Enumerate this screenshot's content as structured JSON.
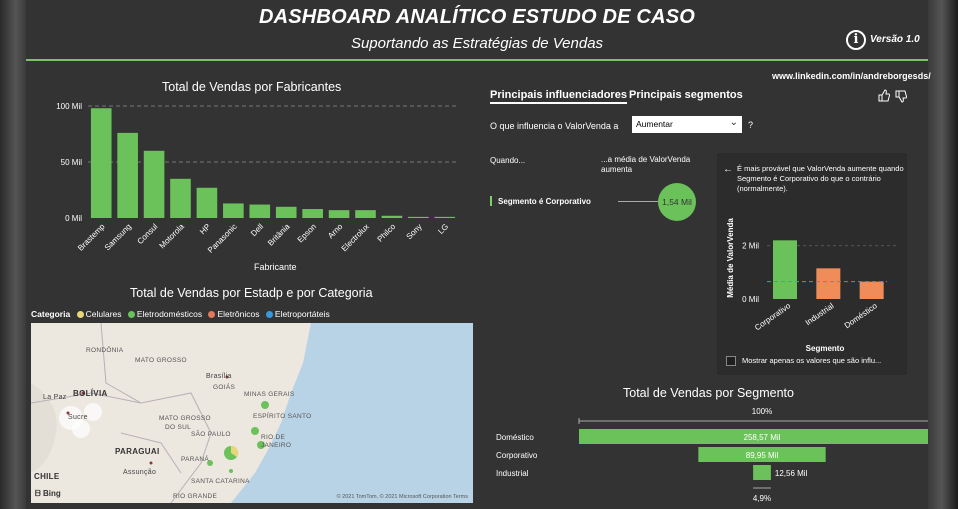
{
  "header": {
    "title": "DASHBOARD ANALÍTICO ESTUDO DE CASO",
    "subtitle": "Suportando as Estratégias de Vendas",
    "info_icon": "info-circle-icon",
    "version": "Versão 1.0",
    "accent_color": "#7fbf6a"
  },
  "linkedin": "www.linkedin.com/in/andreborgesds/",
  "colors": {
    "bar_green": "#6cc25a",
    "bar_orange": "#f08c5a",
    "celulares": "#e8d77a",
    "eletrodomesticos": "#6cc25a",
    "eletronicos": "#e07a5a",
    "eletroportateis": "#3a9ad9"
  },
  "chart_data": [
    {
      "id": "fabricantes",
      "type": "bar",
      "title": "Total de Vendas por Fabricantes",
      "xlabel": "Fabricante",
      "ylabel": "",
      "categories": [
        "Brastemp",
        "Samsung",
        "Consul",
        "Motorola",
        "HP",
        "Panasonic",
        "Dell",
        "Britânia",
        "Epson",
        "Arno",
        "Electrolux",
        "Philco",
        "Sony",
        "LG"
      ],
      "values": [
        98,
        76,
        60,
        35,
        27,
        13,
        12,
        10,
        8,
        7,
        7,
        2,
        1,
        1
      ],
      "yticks": [
        "0 Mil",
        "50 Mil",
        "100 Mil"
      ],
      "ylim": [
        0,
        100
      ],
      "grid": true
    },
    {
      "id": "segmento_influencia",
      "type": "bar",
      "title": "",
      "xlabel": "Segmento",
      "ylabel": "Média de ValorVenda",
      "categories": [
        "Corporativo",
        "Industrial",
        "Doméstico"
      ],
      "values": [
        2.2,
        1.15,
        0.65
      ],
      "yticks": [
        "0 Mil",
        "2 Mil"
      ],
      "ylim": [
        0,
        2.4
      ],
      "average_line": 0.65
    },
    {
      "id": "segmento_vendas",
      "type": "bar",
      "orientation": "horizontal-funnel",
      "title": "Total de Vendas por Segmento",
      "categories": [
        "Doméstico",
        "Corporativo",
        "Industrial"
      ],
      "values": [
        258.57,
        89.95,
        12.56
      ],
      "value_labels": [
        "258,57 Mil",
        "89,95 Mil",
        "12,56 Mil"
      ],
      "top_label": "100%",
      "bottom_label": "4,9%"
    }
  ],
  "map_section": {
    "title": "Total de Vendas por Estadp e por Categoria",
    "legend_title": "Categoria",
    "legend": [
      "Celulares",
      "Eletrodomésticos",
      "Eletrônicos",
      "Eletroportáteis"
    ],
    "labels": {
      "rondonia": "RONDÔNIA",
      "mato_grosso": "MATO GROSSO",
      "bolivia": "BOLÍVIA",
      "brasilia": "Brasília",
      "goias": "GOIÁS",
      "minas": "MINAS GERAIS",
      "la_paz": "La Paz",
      "sucre": "Sucre",
      "mato_grosso_sul": "MATO GROSSO",
      "do_sul": "DO SUL",
      "espirito_santo": "ESPÍRITO SANTO",
      "sao_paulo": "SÃO PAULO",
      "rio": "RIO DE",
      "janeiro": "JANEIRO",
      "paraguai": "PARAGUAI",
      "parana": "PARANÁ",
      "assuncao": "Assunção",
      "santa_catarina": "SANTA CATARINA",
      "chile": "CHILE",
      "rio_grande": "RIO GRANDE",
      "bing": "Bing",
      "copyright": "© 2021 TomTom, © 2021 Microsoft Corporation  Terms"
    }
  },
  "influencers": {
    "tab_influencers": "Principais influenciadores",
    "tab_segments": "Principais segmentos",
    "question": "O que influencia o ValorVenda a",
    "dropdown_value": "Aumentar",
    "question_mark": "?",
    "when_label": "Quando...",
    "avg_label_1": "...a média de ValorVenda",
    "avg_label_2": "aumenta",
    "segment_label": "Segmento é Corporativo",
    "bubble_value": "1,54 Mil",
    "detail_text": "É mais provável que ValorVenda aumente quando Segmento é Corporativo do que o contrário (normalmente).",
    "checkbox_label": "Mostrar apenas os valores que são influ...",
    "thumbs_up": "thumbs-up-icon",
    "thumbs_down": "thumbs-down-icon"
  }
}
